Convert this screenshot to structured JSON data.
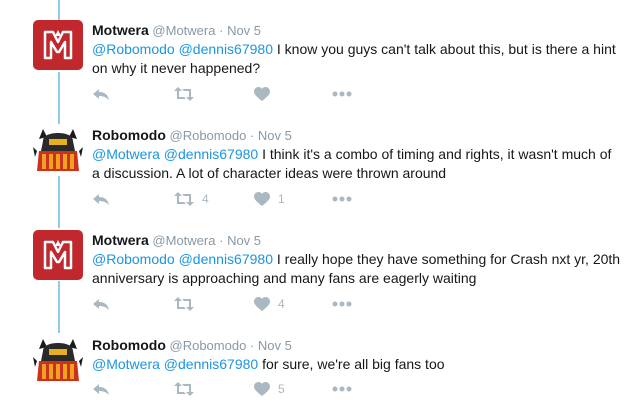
{
  "tweets": [
    {
      "name": "Motwera",
      "handle": "@Motwera",
      "dot": "·",
      "date": "Nov 5",
      "avatar": "motwera-logo-icon",
      "mention1": "@Robomodo",
      "mention2": "@dennis67980",
      "body": " I know you guys can't talk about this, but is there a hint on why it never happened?",
      "retweets": "",
      "likes": ""
    },
    {
      "name": "Robomodo",
      "handle": "@Robomodo",
      "dot": "·",
      "date": "Nov 5",
      "avatar": "robomodo-logo-icon",
      "mention1": "@Motwera",
      "mention2": "@dennis67980",
      "body": " I think it's a combo of timing and rights, it wasn't much of a discussion. A lot of character ideas were thrown around",
      "retweets": "4",
      "likes": "1"
    },
    {
      "name": "Motwera",
      "handle": "@Motwera",
      "dot": "·",
      "date": "Nov 5",
      "avatar": "motwera-logo-icon",
      "mention1": "@Robomodo",
      "mention2": "@dennis67980",
      "body": " I really hope they have something for Crash nxt yr, 20th anniversary is approaching and many fans are eagerly waiting",
      "retweets": "",
      "likes": "4"
    },
    {
      "name": "Robomodo",
      "handle": "@Robomodo",
      "dot": "·",
      "date": "Nov 5",
      "avatar": "robomodo-logo-icon",
      "mention1": "@Motwera",
      "mention2": "@dennis67980",
      "body": " for sure, we're all big fans too",
      "retweets": "",
      "likes": "5"
    }
  ],
  "icons": {
    "reply": "reply-icon",
    "retweet": "retweet-icon",
    "like": "heart-icon",
    "more": "more-dots-icon"
  },
  "colors": {
    "mention": "#1b95e0",
    "thread_line": "#8fcce8",
    "muted": "#8899a6",
    "action": "#aab8c2",
    "motwera_red": "#c0282d"
  }
}
